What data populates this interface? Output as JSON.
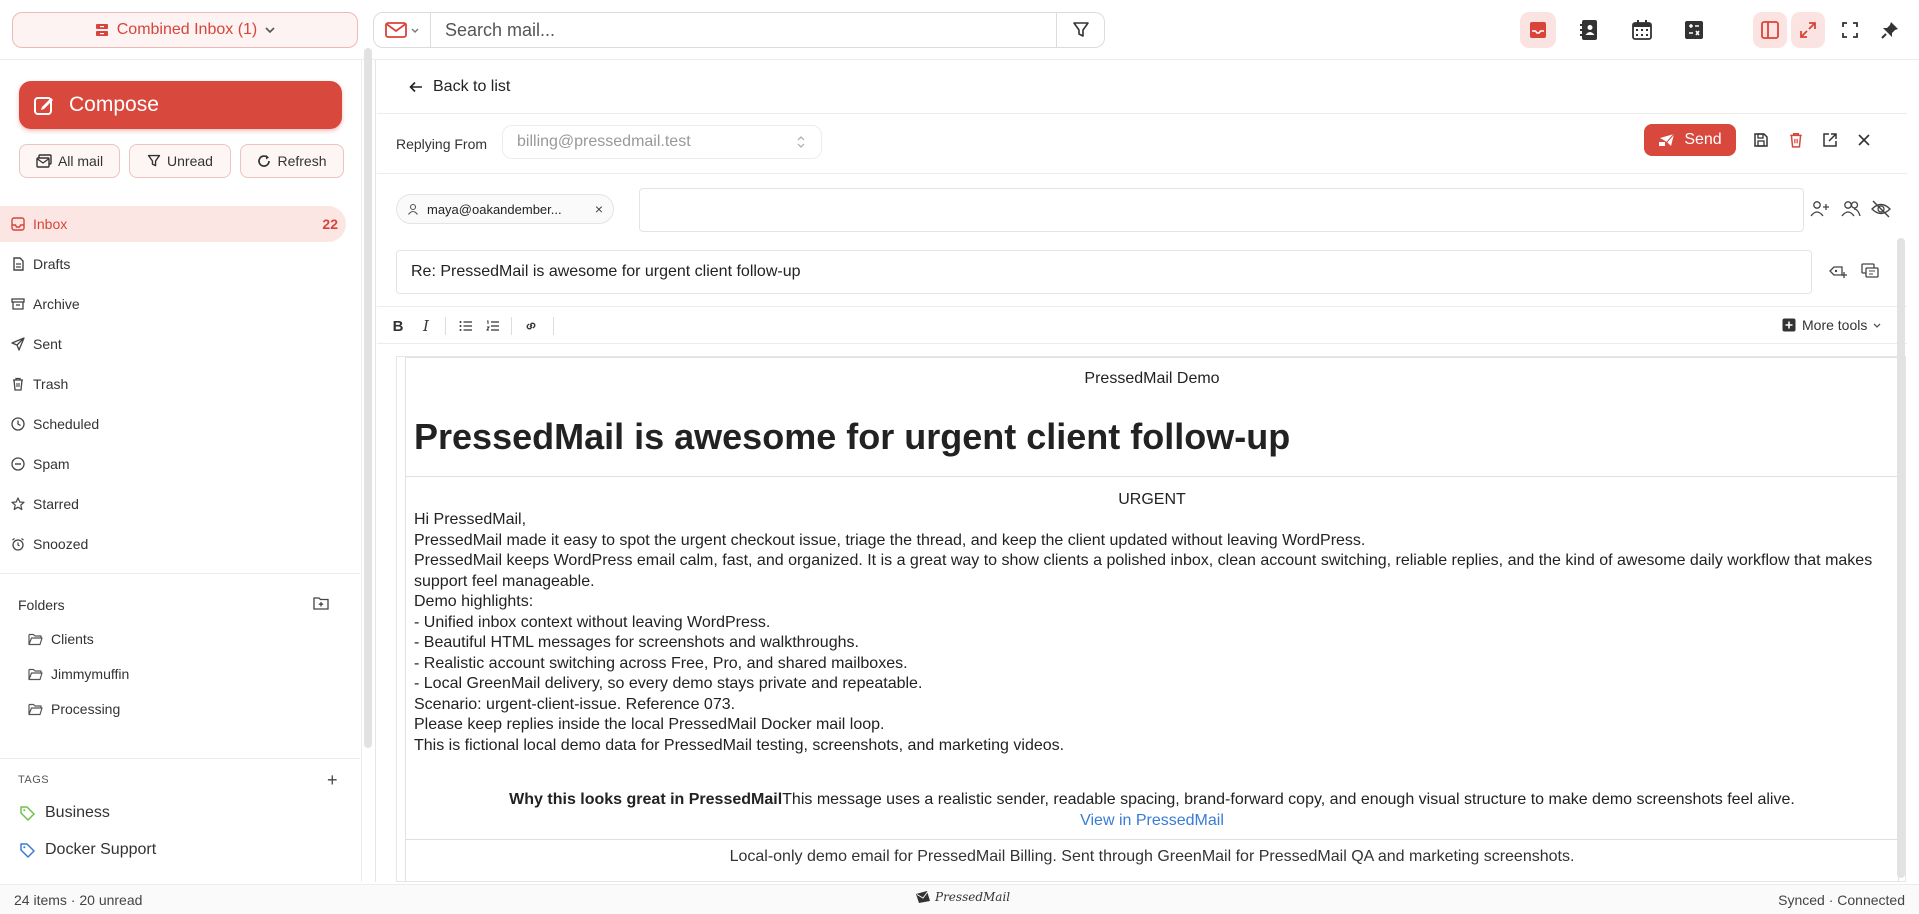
{
  "topbar": {
    "account": "Combined Inbox (1)",
    "search_placeholder": "Search mail..."
  },
  "sidebar": {
    "compose": "Compose",
    "filters": [
      {
        "label": "All mail"
      },
      {
        "label": "Unread"
      },
      {
        "label": "Refresh"
      }
    ],
    "nav": [
      {
        "label": "Inbox",
        "count": "22",
        "icon": "inbox-icon"
      },
      {
        "label": "Drafts",
        "icon": "file-icon"
      },
      {
        "label": "Archive",
        "icon": "archive-icon"
      },
      {
        "label": "Sent",
        "icon": "send-icon"
      },
      {
        "label": "Trash",
        "icon": "trash-icon"
      },
      {
        "label": "Scheduled",
        "icon": "clock-icon"
      },
      {
        "label": "Spam",
        "icon": "ban-icon"
      },
      {
        "label": "Starred",
        "icon": "star-icon"
      },
      {
        "label": "Snoozed",
        "icon": "alarm-icon"
      }
    ],
    "folders_label": "Folders",
    "folders": [
      "Clients",
      "Jimmymuffin",
      "Processing"
    ],
    "tags_label": "TAGS",
    "tags": [
      {
        "label": "Business",
        "color": "#6cc24a"
      },
      {
        "label": "Docker Support",
        "color": "#3a7bd5"
      }
    ]
  },
  "composer": {
    "back": "Back to list",
    "replying_from_label": "Replying From",
    "from_address": "billing@pressedmail.test",
    "send": "Send",
    "recipient": "maya@oakandember...",
    "subject": "Re: PressedMail is awesome for urgent client follow-up",
    "more_tools": "More tools"
  },
  "email": {
    "header": "PressedMail Demo",
    "title": "PressedMail is awesome for urgent client follow-up",
    "badge": "URGENT",
    "lines": [
      "Hi PressedMail,",
      "PressedMail made it easy to spot the urgent checkout issue, triage the thread, and keep the client updated without leaving WordPress.",
      "PressedMail keeps WordPress email calm, fast, and organized. It is a great way to show clients a polished inbox, clean account switching, reliable replies, and the kind of awesome daily workflow that makes support feel manageable.",
      "Demo highlights:",
      "- Unified inbox context without leaving WordPress.",
      "- Beautiful HTML messages for screenshots and walkthroughs.",
      "- Realistic account switching across Free, Pro, and shared mailboxes.",
      "- Local GreenMail delivery, so every demo stays private and repeatable.",
      "Scenario: urgent-client-issue. Reference 073.",
      "Please keep replies inside the local PressedMail Docker mail loop.",
      "This is fictional local demo data for PressedMail testing, screenshots, and marketing videos."
    ],
    "why_bold": "Why this looks great in PressedMail",
    "why_text": "This message uses a realistic sender, readable spacing, brand-forward copy, and enough visual structure to make demo screenshots feel alive.",
    "view_link": "View in PressedMail",
    "footer": "Local-only demo email for PressedMail Billing. Sent through GreenMail for PressedMail QA and marketing screenshots."
  },
  "status": {
    "left": "24 items · 20 unread",
    "logo": "PressedMail",
    "right": "Synced · Connected"
  },
  "colors": {
    "accent": "#d9483d",
    "accent_soft": "#fbe6e4",
    "link": "#3a7bd5"
  }
}
